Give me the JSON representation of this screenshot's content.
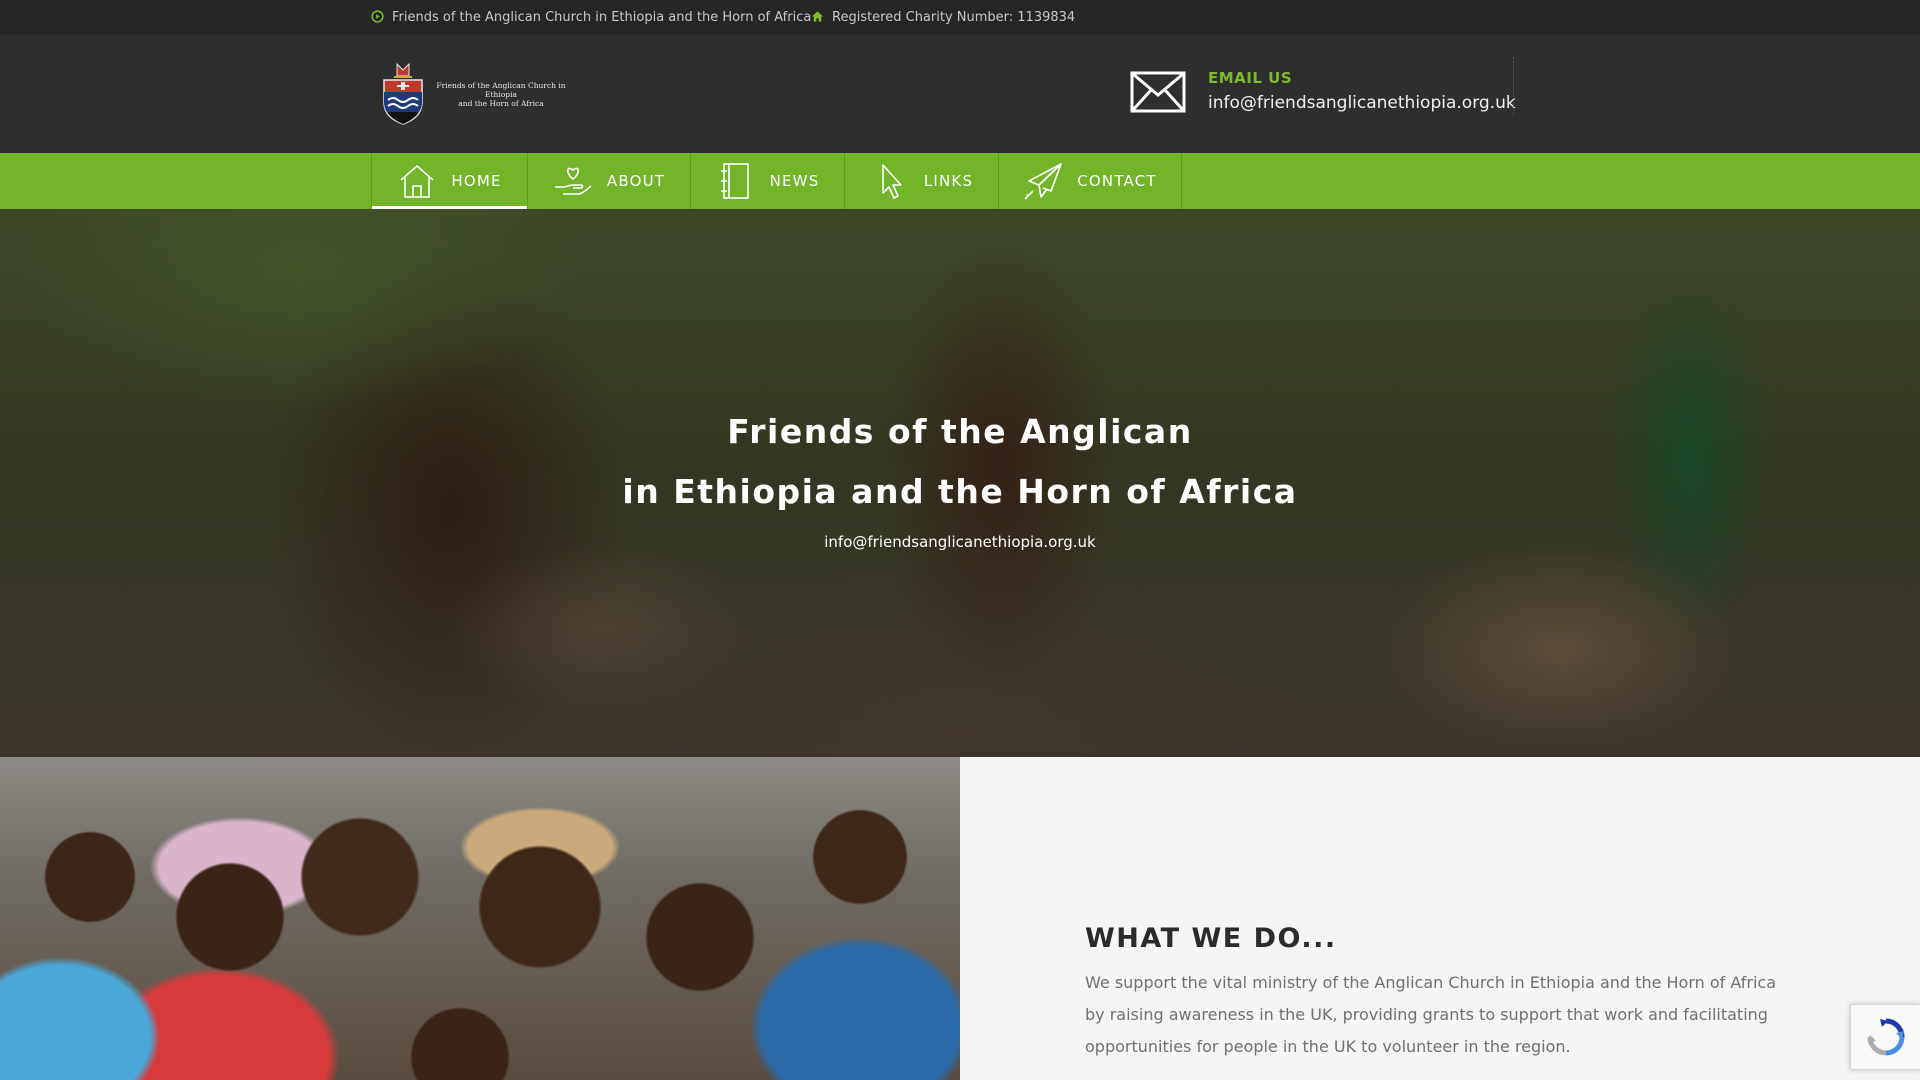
{
  "topbar": {
    "org_name": "Friends of the Anglican Church in Ethiopia and the Horn of Africa",
    "org_icon": "circle-play-icon",
    "charity": "Registered Charity Number: 1139834",
    "charity_icon": "home-icon"
  },
  "header": {
    "logo_text_line1": "Friends of the Anglican Church in Ethiopia",
    "logo_text_line2": "and the Horn of Africa",
    "email_label": "EMAIL US",
    "email_value": "info@friendsanglicanethiopia.org.uk"
  },
  "nav": {
    "items": [
      {
        "label": "HOME",
        "icon": "home-icon",
        "active": true
      },
      {
        "label": "ABOUT",
        "icon": "hand-heart-icon",
        "active": false
      },
      {
        "label": "NEWS",
        "icon": "notebook-icon",
        "active": false
      },
      {
        "label": "LINKS",
        "icon": "cursor-icon",
        "active": false
      },
      {
        "label": "CONTACT",
        "icon": "paper-plane-icon",
        "active": false
      }
    ]
  },
  "hero": {
    "title_line1": "Friends of the Anglican",
    "title_line2": "in Ethiopia and the Horn of Africa",
    "subtitle": "info@friendsanglicanethiopia.org.uk"
  },
  "about": {
    "title": "WHAT WE DO...",
    "text": "We support the vital ministry of the Anglican Church in Ethiopia and the Horn of Africa by raising awareness in the UK, providing grants to support that work and facilitating opportunities for people in the UK to volunteer in the region."
  },
  "colors": {
    "accent": "#72b42a",
    "accent_text": "#7dbb2a",
    "topbar_bg": "#262626",
    "header_bg": "#2e2e2e"
  }
}
